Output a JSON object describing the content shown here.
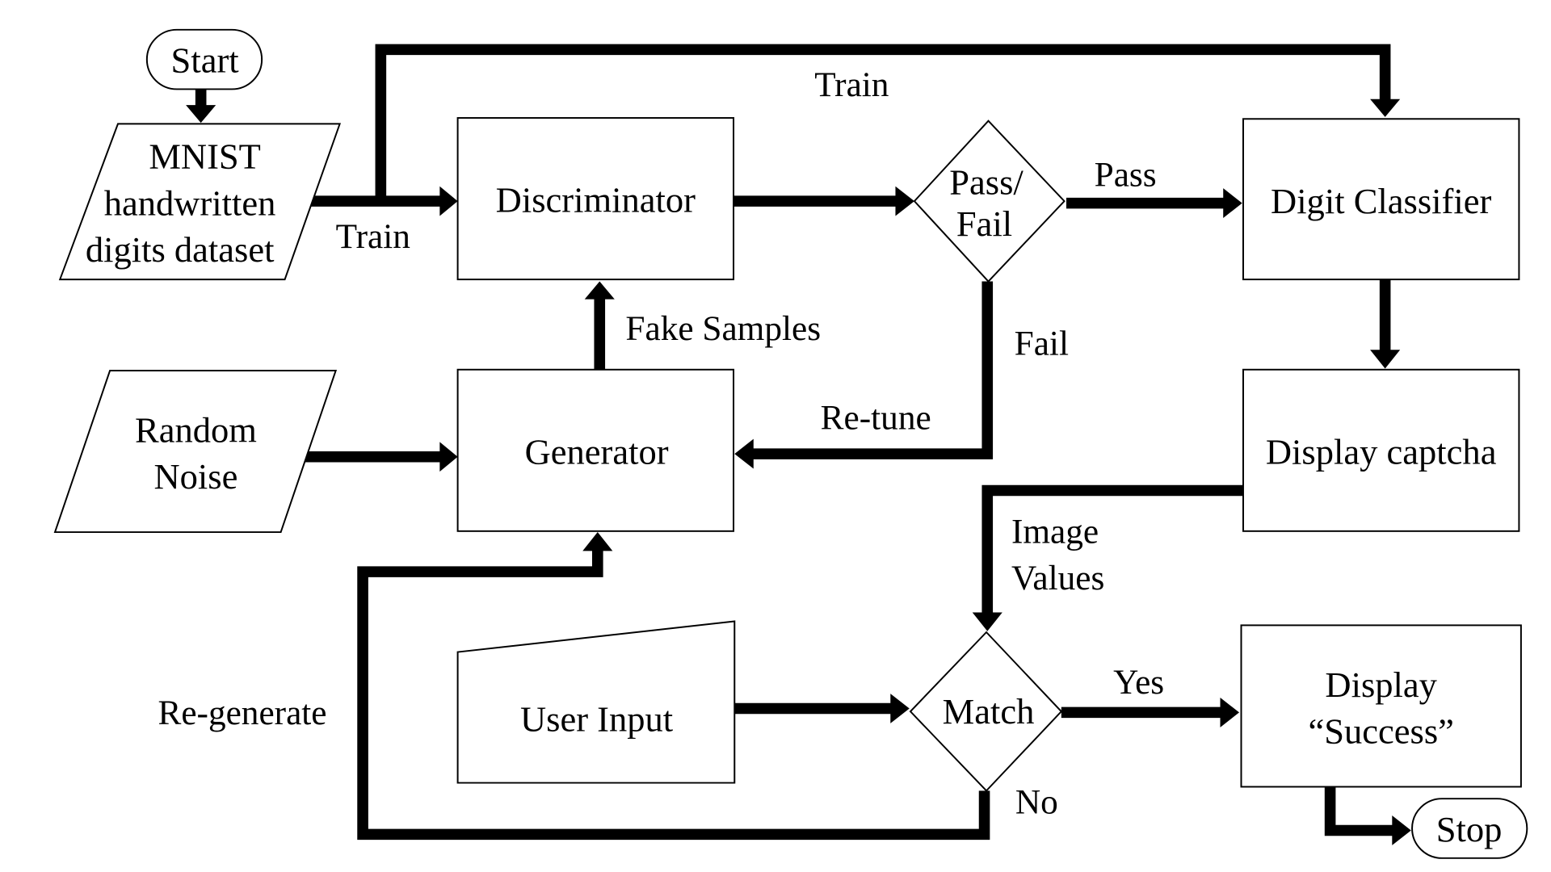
{
  "diagram": {
    "type": "flowchart",
    "title": "",
    "nodes": {
      "start": {
        "shape": "terminal",
        "lines": [
          "Start"
        ]
      },
      "mnist": {
        "shape": "data-parallelogram",
        "lines": [
          "MNIST",
          "handwritten",
          "digits dataset"
        ]
      },
      "discriminator": {
        "shape": "process",
        "lines": [
          "Discriminator"
        ]
      },
      "pass_fail": {
        "shape": "decision",
        "lines": [
          "Pass/",
          "Fail"
        ]
      },
      "digit_classifier": {
        "shape": "process",
        "lines": [
          "Digit Classifier"
        ]
      },
      "random_noise": {
        "shape": "data-parallelogram",
        "lines": [
          "Random",
          "Noise"
        ]
      },
      "generator": {
        "shape": "process",
        "lines": [
          "Generator"
        ]
      },
      "display_captcha": {
        "shape": "process",
        "lines": [
          "Display captcha"
        ]
      },
      "user_input": {
        "shape": "manual-input",
        "lines": [
          "User Input"
        ]
      },
      "match": {
        "shape": "decision",
        "lines": [
          "Match"
        ]
      },
      "display_success": {
        "shape": "process",
        "lines": [
          "Display",
          "“Success”"
        ]
      },
      "stop": {
        "shape": "terminal",
        "lines": [
          "Stop"
        ]
      }
    },
    "edges": [
      {
        "from": "start",
        "to": "mnist",
        "label": ""
      },
      {
        "from": "mnist",
        "to": "discriminator",
        "label": "Train"
      },
      {
        "from": "mnist",
        "to": "digit_classifier",
        "label": "Train"
      },
      {
        "from": "discriminator",
        "to": "pass_fail",
        "label": ""
      },
      {
        "from": "pass_fail",
        "to": "digit_classifier",
        "label": "Pass"
      },
      {
        "from": "pass_fail",
        "to": "generator",
        "label": "Fail",
        "label2": "Re-tune"
      },
      {
        "from": "generator",
        "to": "discriminator",
        "label": "Fake Samples"
      },
      {
        "from": "random_noise",
        "to": "generator",
        "label": ""
      },
      {
        "from": "digit_classifier",
        "to": "display_captcha",
        "label": ""
      },
      {
        "from": "display_captcha",
        "to": "match",
        "label": "Image Values",
        "lines": [
          "Image",
          "Values"
        ]
      },
      {
        "from": "user_input",
        "to": "match",
        "label": ""
      },
      {
        "from": "match",
        "to": "display_success",
        "label": "Yes"
      },
      {
        "from": "match",
        "to": "generator",
        "label": "No",
        "label2": "Re-generate"
      },
      {
        "from": "display_success",
        "to": "stop",
        "label": ""
      }
    ]
  }
}
